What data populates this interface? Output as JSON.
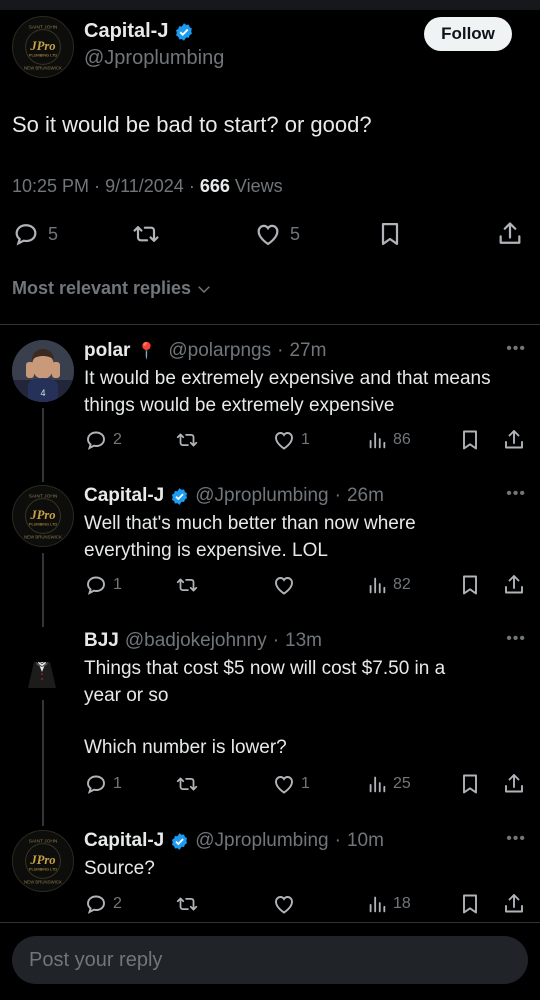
{
  "main_post": {
    "author_name": "Capital-J",
    "author_handle": "@Jproplumbing",
    "follow_label": "Follow",
    "text": "So it would be bad to start? or good?",
    "time": "10:25 PM",
    "date": "9/11/2024",
    "views_count": "666",
    "views_label": "Views",
    "replies": "5",
    "likes": "5"
  },
  "logo": {
    "top": "SAINT JOHN",
    "brand": "JPro",
    "sub": "PLUMBING LTD",
    "bottom": "NEW BRUNSWICK"
  },
  "sort_label": "Most relevant replies",
  "replies": [
    {
      "name": "polar",
      "emoji": "📍",
      "handle": "@polarpngs",
      "time": "27m",
      "lines": [
        "It would be extremely expensive and that means",
        "things would be extremely expensive"
      ],
      "replies": "2",
      "likes": "1",
      "views": "86"
    },
    {
      "name": "Capital-J",
      "handle": "@Jproplumbing",
      "time": "26m",
      "lines": [
        "Well that's much better than now where",
        "everything is expensive. LOL"
      ],
      "replies": "1",
      "likes": "",
      "views": "82"
    },
    {
      "name": "BJJ",
      "handle": "@badjokejohnny",
      "time": "13m",
      "lines": [
        "Things that cost $5 now will cost $7.50 in a",
        "year or so",
        "",
        "Which number is lower?"
      ],
      "replies": "1",
      "likes": "1",
      "views": "25"
    },
    {
      "name": "Capital-J",
      "handle": "@Jproplumbing",
      "time": "10m",
      "lines": [
        "Source?"
      ],
      "replies": "2",
      "likes": "",
      "views": "18"
    }
  ],
  "compose": {
    "placeholder": "Post your reply"
  },
  "colors": {
    "background": "#000000",
    "text": "#e7e9ea",
    "muted": "#71767b",
    "verified": "#1d9bf0",
    "logo_gold": "#c8a24a"
  },
  "icons": [
    "verified-icon",
    "reply-icon",
    "repost-icon",
    "like-icon",
    "bookmark-icon",
    "share-icon",
    "views-icon",
    "chevron-down-icon",
    "more-icon"
  ]
}
